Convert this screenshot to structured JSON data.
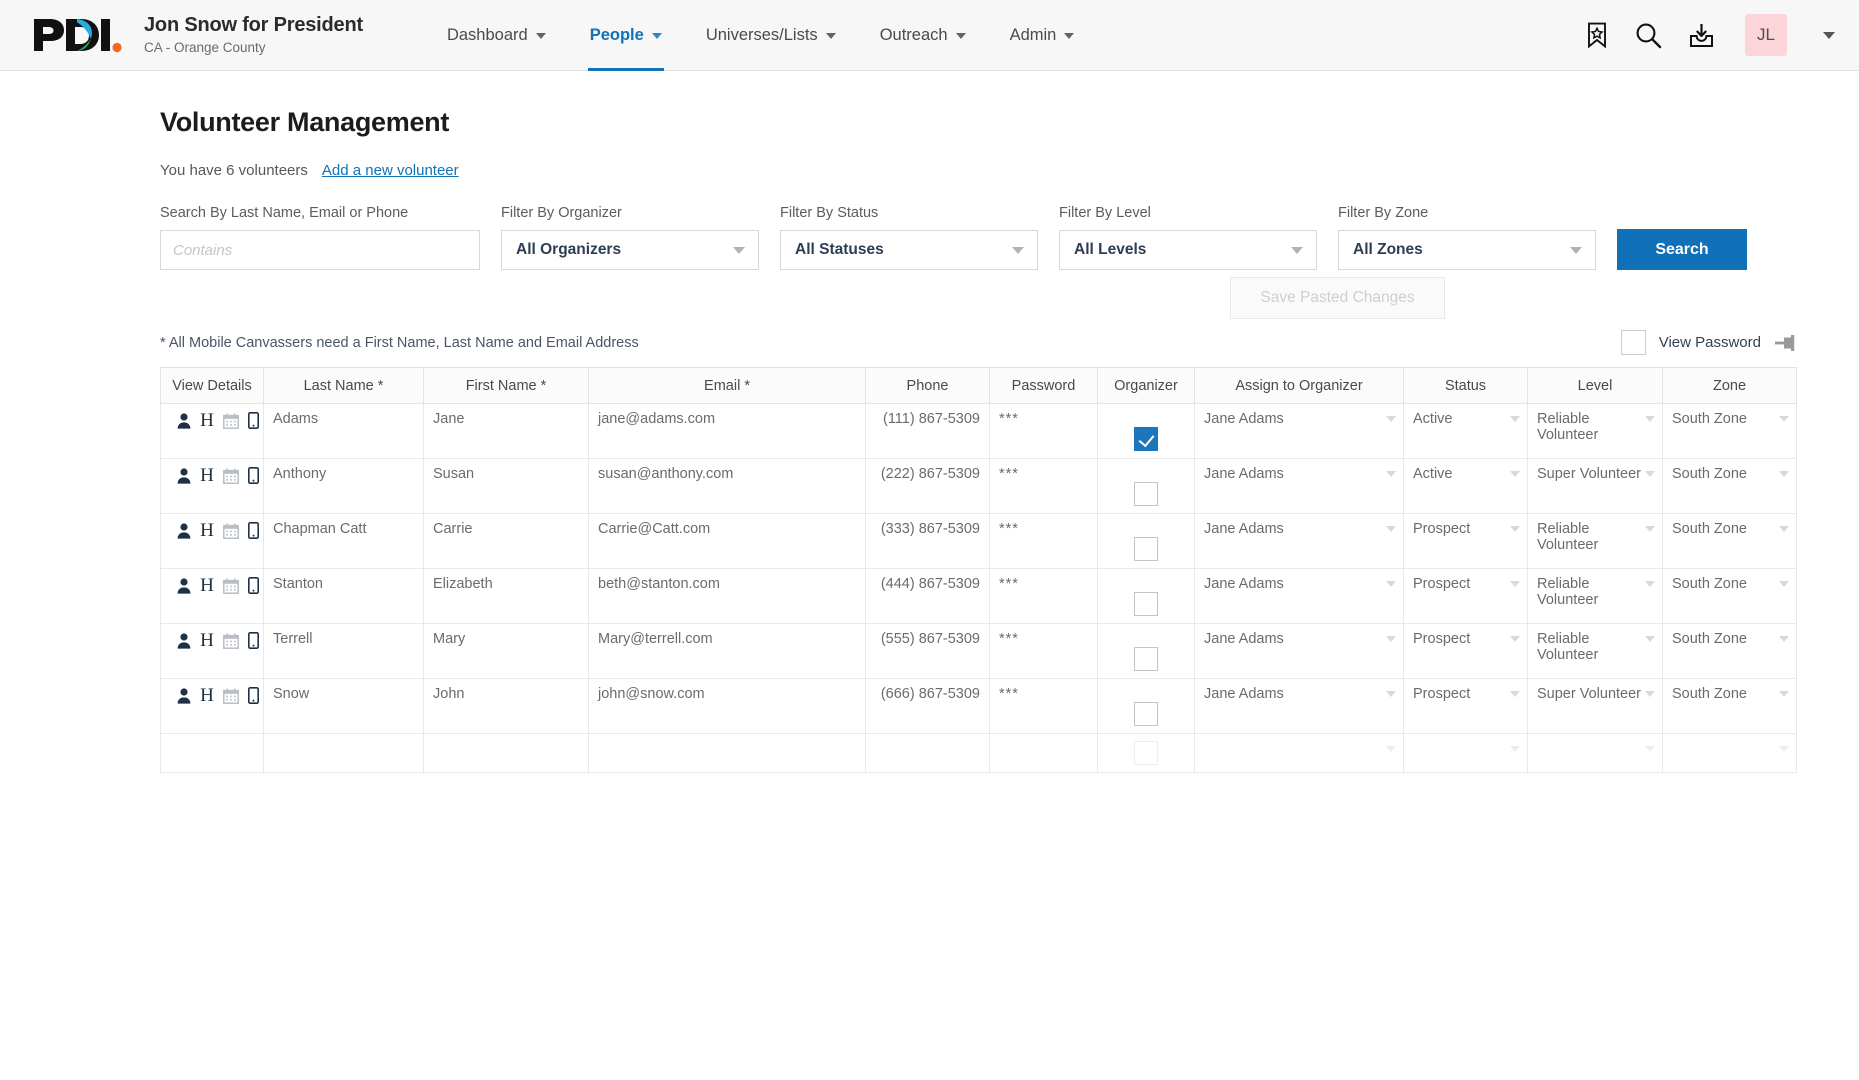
{
  "header": {
    "logo_name": "pdi-logo",
    "campaign_title": "Jon Snow for President",
    "campaign_sub": "CA - Orange County",
    "nav": [
      {
        "label": "Dashboard",
        "active": false
      },
      {
        "label": "People",
        "active": true
      },
      {
        "label": "Universes/Lists",
        "active": false
      },
      {
        "label": "Outreach",
        "active": false
      },
      {
        "label": "Admin",
        "active": false
      }
    ],
    "icons": [
      "bookmark-star-icon",
      "search-icon",
      "download-inbox-icon"
    ],
    "avatar_initials": "JL",
    "avatar_bg": "#fbd5d9"
  },
  "page": {
    "title": "Volunteer Management",
    "count_text": "You have 6 volunteers",
    "add_link": "Add a new volunteer",
    "save_pasted_label": "Save Pasted Changes",
    "note": "* All Mobile Canvassers need a First Name, Last Name and Email Address",
    "view_password_label": "View Password",
    "view_password_checked": false,
    "pin_icon": "pushpin-icon"
  },
  "filters": {
    "search": {
      "label": "Search By Last Name, Email or Phone",
      "value": "",
      "placeholder": "Contains"
    },
    "organizer": {
      "label": "Filter By Organizer",
      "value": "All Organizers"
    },
    "status": {
      "label": "Filter By Status",
      "value": "All Statuses"
    },
    "level": {
      "label": "Filter By Level",
      "value": "All Levels"
    },
    "zone": {
      "label": "Filter By Zone",
      "value": "All Zones"
    },
    "search_button": "Search"
  },
  "accent_colors": {
    "brand_blue": "#1272b8",
    "button_blue": "#1071b8",
    "checkbox_blue": "#1b76bc",
    "link_blue": "#1272b8"
  },
  "table": {
    "columns": [
      "View Details",
      "Last Name *",
      "First Name *",
      "Email *",
      "Phone",
      "Password",
      "Organizer",
      "Assign to Organizer",
      "Status",
      "Level",
      "Zone"
    ],
    "row_icons": [
      "person-icon",
      "letter-h-icon",
      "calendar-icon",
      "mobile-phone-icon"
    ],
    "rows": [
      {
        "last_name": "Adams",
        "first_name": "Jane",
        "email": "jane@adams.com",
        "phone": "(111) 867-5309",
        "password": "***",
        "organizer": true,
        "assign_to_organizer": "Jane Adams",
        "status": "Active",
        "level": "Reliable Volunteer",
        "zone": "South Zone"
      },
      {
        "last_name": "Anthony",
        "first_name": "Susan",
        "email": "susan@anthony.com",
        "phone": "(222) 867-5309",
        "password": "***",
        "organizer": false,
        "assign_to_organizer": "Jane Adams",
        "status": "Active",
        "level": "Super Volunteer",
        "zone": "South Zone"
      },
      {
        "last_name": "Chapman Catt",
        "first_name": "Carrie",
        "email": "Carrie@Catt.com",
        "phone": "(333) 867-5309",
        "password": "***",
        "organizer": false,
        "assign_to_organizer": "Jane Adams",
        "status": "Prospect",
        "level": "Reliable Volunteer",
        "zone": "South Zone"
      },
      {
        "last_name": "Stanton",
        "first_name": "Elizabeth",
        "email": "beth@stanton.com",
        "phone": "(444) 867-5309",
        "password": "***",
        "organizer": false,
        "assign_to_organizer": "Jane Adams",
        "status": "Prospect",
        "level": "Reliable Volunteer",
        "zone": "South Zone"
      },
      {
        "last_name": "Terrell",
        "first_name": "Mary",
        "email": "Mary@terrell.com",
        "phone": "(555) 867-5309",
        "password": "***",
        "organizer": false,
        "assign_to_organizer": "Jane Adams",
        "status": "Prospect",
        "level": "Reliable Volunteer",
        "zone": "South Zone"
      },
      {
        "last_name": "Snow",
        "first_name": "John",
        "email": "john@snow.com",
        "phone": "(666) 867-5309",
        "password": "***",
        "organizer": false,
        "assign_to_organizer": "Jane Adams",
        "status": "Prospect",
        "level": "Super Volunteer",
        "zone": "South Zone"
      },
      {
        "last_name": "",
        "first_name": "",
        "email": "",
        "phone": "",
        "password": "",
        "organizer": false,
        "assign_to_organizer": "",
        "status": "",
        "level": "",
        "zone": "",
        "empty": true
      }
    ]
  }
}
